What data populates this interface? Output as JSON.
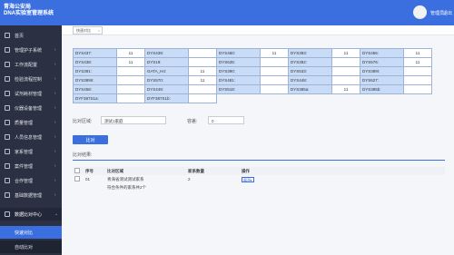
{
  "header": {
    "title_line1": "青海公安局",
    "title_line2": "DNA实验室管理系统",
    "user": "管理员",
    "logout": "退出"
  },
  "sidebar": {
    "items": [
      {
        "label": "首页",
        "icon": "home-icon",
        "arrow": ""
      },
      {
        "label": "管理护子系统",
        "icon": "shield-icon",
        "arrow": "›"
      },
      {
        "label": "工作流配置",
        "icon": "flow-icon",
        "arrow": "›"
      },
      {
        "label": "检验流程控制",
        "icon": "flask-icon",
        "arrow": "›"
      },
      {
        "label": "试剂耗材管理",
        "icon": "box-icon",
        "arrow": "›"
      },
      {
        "label": "仪器设备管理",
        "icon": "device-icon",
        "arrow": "›"
      },
      {
        "label": "质量管理",
        "icon": "quality-icon",
        "arrow": "›"
      },
      {
        "label": "人员信息管理",
        "icon": "user-icon",
        "arrow": "›"
      },
      {
        "label": "家系管理",
        "icon": "family-icon",
        "arrow": "›"
      },
      {
        "label": "案件管理",
        "icon": "case-icon",
        "arrow": "›"
      },
      {
        "label": "合作管理",
        "icon": "handshake-icon",
        "arrow": "›"
      },
      {
        "label": "基础数据管理",
        "icon": "database-icon",
        "arrow": "›"
      },
      {
        "label": "数据比对中心",
        "icon": "compare-icon",
        "arrow": "⌄"
      },
      {
        "label": "快速对比",
        "icon": "",
        "arrow": ""
      },
      {
        "label": "自动比对",
        "icon": "",
        "arrow": ""
      }
    ]
  },
  "tabs": [
    {
      "label": "快速对比"
    }
  ],
  "str_grid": {
    "rows": [
      [
        {
          "l": "DYS437:",
          "v": "11"
        },
        {
          "l": "DYS439:",
          "v": ""
        },
        {
          "l": "DYS460:",
          "v": "11"
        },
        {
          "l": "DYS393:",
          "v": "11"
        },
        {
          "l": "DYS456:",
          "v": "11"
        }
      ],
      [
        {
          "l": "DYS438:",
          "v": "11"
        },
        {
          "l": "DYS19:",
          "v": ""
        },
        {
          "l": "DYS635:",
          "v": ""
        },
        {
          "l": "DYS392:",
          "v": ""
        },
        {
          "l": "DYS576:",
          "v": "11"
        }
      ],
      [
        {
          "l": "DYS391:",
          "v": ""
        },
        {
          "l": "GATA_H4:",
          "v": "11"
        },
        {
          "l": "DYS390:",
          "v": ""
        },
        {
          "l": "DYS533:",
          "v": ""
        },
        {
          "l": "DYS389I:",
          "v": ""
        }
      ],
      [
        {
          "l": "DYS389II:",
          "v": ""
        },
        {
          "l": "DYS570:",
          "v": "11"
        },
        {
          "l": "DYS481:",
          "v": ""
        },
        {
          "l": "DYS448:",
          "v": ""
        },
        {
          "l": "DYS627:",
          "v": ""
        }
      ],
      [
        {
          "l": "DYS458:",
          "v": ""
        },
        {
          "l": "DYS449:",
          "v": ""
        },
        {
          "l": "DYS518:",
          "v": ""
        },
        {
          "l": "DYS385a:",
          "v": "11"
        },
        {
          "l": "DYS385b:",
          "v": ""
        }
      ],
      [
        {
          "l": "DYF387S1a:",
          "v": ""
        },
        {
          "l": "DYF387S1b:",
          "v": ""
        }
      ]
    ]
  },
  "form": {
    "compare_area_label": "比对区域:",
    "compare_area_value": "测试1家庭",
    "tolerance_label": "容差:",
    "tolerance_value": "0",
    "compare_button": "比对"
  },
  "results": {
    "label": "比对结果:",
    "headers": [
      "",
      "序号",
      "比对区域",
      "家系数量",
      "操作"
    ],
    "rows": [
      {
        "index": "01",
        "area": "青海省测试测试家系",
        "count": "2",
        "action": "展开"
      }
    ],
    "summary": "符合条件的家系共2个"
  },
  "colors": {
    "header_blue": "#3b6fe0",
    "sidebar_dark": "#2b3142",
    "grid_label_bg": "#c9dcf7"
  }
}
